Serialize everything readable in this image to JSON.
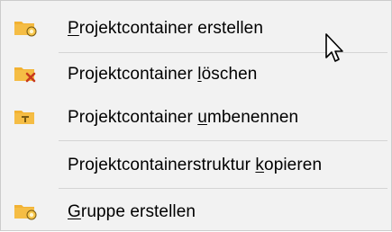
{
  "menu": {
    "items": [
      {
        "pre": "",
        "ul": "P",
        "post": "rojektcontainer erstellen",
        "icon": "folder-new-icon"
      },
      {
        "pre": "Projektcontainer ",
        "ul": "l",
        "post": "öschen",
        "icon": "folder-delete-icon"
      },
      {
        "pre": "Projektcontainer ",
        "ul": "u",
        "post": "mbenennen",
        "icon": "folder-rename-icon"
      },
      {
        "pre": "Projektcontainerstruktur ",
        "ul": "k",
        "post": "opieren",
        "icon": ""
      },
      {
        "pre": "",
        "ul": "G",
        "post": "ruppe erstellen",
        "icon": "folder-group-new-icon"
      }
    ]
  },
  "colors": {
    "folder": "#f2b233",
    "folder_dark": "#d9921a",
    "badge": "#f7c64a",
    "delete_x": "#c8391d"
  }
}
